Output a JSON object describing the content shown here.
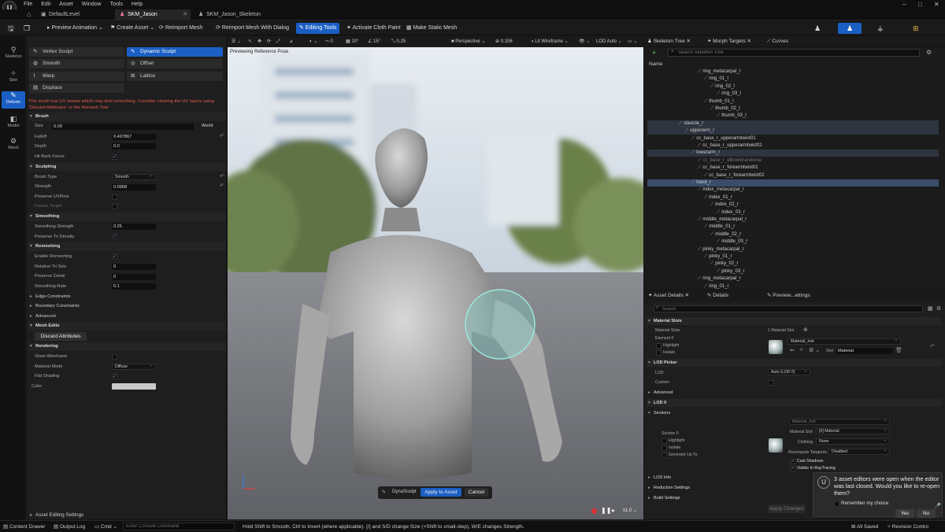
{
  "menu": {
    "items": [
      "File",
      "Edit",
      "Asset",
      "Window",
      "Tools",
      "Help"
    ]
  },
  "window_controls": {
    "minimize": "–",
    "maximize": "□",
    "close": "✕"
  },
  "tabs": [
    {
      "label": "DefaultLevel"
    },
    {
      "label": "SKM_Jason"
    },
    {
      "label": "SKM_Jason_Skeleton"
    }
  ],
  "toolbar": {
    "preview_animation": "Preview Animation",
    "create_asset": "Create Asset",
    "reimport_mesh": "Reimport Mesh",
    "reimport_with_dialog": "Reimport Mesh With Dialog",
    "editing_tools": "Editing Tools",
    "activate_cloth_paint": "Activate Cloth Paint",
    "make_static_mesh": "Make Static Mesh"
  },
  "left_strip": [
    {
      "label": "Skeleton"
    },
    {
      "label": "Skin"
    },
    {
      "label": "Deform"
    },
    {
      "label": "Model"
    },
    {
      "label": "Mesh"
    }
  ],
  "sculpt_modes": [
    {
      "label": "Vertex Sculpt"
    },
    {
      "label": "Dynamic Sculpt"
    },
    {
      "label": "Smooth"
    },
    {
      "label": "Offset"
    },
    {
      "label": "Warp"
    },
    {
      "label": "Lattice"
    },
    {
      "label": "Displace"
    }
  ],
  "warning": "This mesh has UV seams which may limit remeshing. Consider clearing the UV layers using \"Discard Attributes\" or the Remesh Tool.",
  "brush": {
    "header": "Brush",
    "size_label": "Size",
    "size_value": "0.09",
    "world": "World",
    "falloff_label": "Falloff",
    "falloff_value": "0.497867",
    "depth_label": "Depth",
    "depth_value": "0.0",
    "hit_back_label": "Hit Back Faces"
  },
  "sculpting": {
    "header": "Sculpting",
    "brush_type_label": "Brush Type",
    "brush_type_value": "Smooth",
    "strength_label": "Strength",
    "strength_value": "0.0968",
    "preserve_uv_label": "Preserve UVFlow",
    "freeze_label": "Freeze Target"
  },
  "smoothing": {
    "header": "Smoothing",
    "strength_label": "Smoothing Strength",
    "strength_value": "0.25",
    "tri_density_label": "Preserve Tri Density"
  },
  "remeshing": {
    "header": "Remeshing",
    "enable_label": "Enable Remeshing",
    "rel_tri_label": "Relative Tri Size",
    "rel_tri_value": "0",
    "preserve_detail_label": "Preserve Detail",
    "preserve_detail_value": "0",
    "smoothing_rate_label": "Smoothing Rate",
    "smoothing_rate_value": "0.1"
  },
  "collapsed": {
    "edge": "Edge Constraints",
    "boundary": "Boundary Constraints",
    "advanced": "Advanced"
  },
  "mesh_edits": {
    "header": "Mesh Edits",
    "discard": "Discard Attributes"
  },
  "rendering": {
    "header": "Rendering",
    "show_wireframe": "Show Wireframe",
    "material_mode_label": "Material Mode",
    "material_mode_value": "Diffuse",
    "flat_shading": "Flat Shading",
    "color_label": "Color"
  },
  "asset_editing": "Asset Editing Settings",
  "viewport": {
    "perspective": "Perspective",
    "fov": "0.106",
    "lit": "Lit Wireframe",
    "lod": "LOD Auto",
    "previewing": "Previewing Reference Pose",
    "snap_angle": "10°",
    "snap_rot": "15°",
    "snap_scale": "0.25",
    "play_rate": "x1.0"
  },
  "sculpt_bar": {
    "label": "DynaSculpt",
    "apply": "Apply to Asset",
    "cancel": "Cancel"
  },
  "right_tabs": {
    "skeleton_tree": "Skeleton Tree",
    "morph_targets": "Morph Targets",
    "curves": "Curves"
  },
  "skeleton": {
    "search_placeholder": "Search Skeleton Tree",
    "name_header": "Name",
    "bones": [
      "ring_metacarpal_l",
      "ring_01_l",
      "ring_02_l",
      "ring_03_l",
      "thumb_01_l",
      "thumb_02_l",
      "thumb_03_l",
      "clavicle_r",
      "upperarm_r",
      "cc_base_r_upperarmtwist01",
      "cc_base_r_upperarmtwist02",
      "lowerarm_r",
      "cc_base_r_elbowsharebone",
      "cc_base_r_forearmtwist01",
      "cc_base_r_forearmtwist02",
      "hand_r",
      "index_metacarpal_r",
      "index_01_r",
      "index_02_r",
      "index_03_r",
      "middle_metacarpal_r",
      "middle_01_r",
      "middle_02_r",
      "middle_03_r",
      "pinky_metacarpal_r",
      "pinky_01_r",
      "pinky_02_r",
      "pinky_03_r",
      "ring_metacarpal_r",
      "ring_01_r"
    ]
  },
  "details_tabs": {
    "asset_details": "Asset Details",
    "details": "Details",
    "preview": "Preview...ettings"
  },
  "details": {
    "search_placeholder": "Search",
    "material_slots_header": "Material Slots",
    "material_slots_label": "Material Slots",
    "slot_count": "1 Material Slot",
    "element0": "Element 0",
    "highlight": "Highlight",
    "isolate": "Isolate",
    "material_name": "Material_Inst",
    "slot_label": "Slot",
    "slot_value": "Material",
    "lod_picker_header": "LOD Picker",
    "lod_label": "LOD",
    "lod_value": "Auto (LOD 0)",
    "custom_label": "Custom",
    "advanced": "Advanced",
    "lod0_header": "LOD 0",
    "sections": "Sections",
    "section0": "Section 0",
    "sec_highlight": "Highlight",
    "sec_isolate": "Isolate",
    "generate_up_to": "Generate Up To",
    "sec_material": "Material_Inst",
    "material_slot_label": "Material Slot",
    "material_slot_value": "[0] Material",
    "clothing_label": "Clothing",
    "clothing_value": "None",
    "recompute_label": "Recompute Tangents",
    "recompute_value": "Disabled",
    "cast_shadows": "Cast Shadows",
    "visible_raytracing": "Visible In RayTracing",
    "lod_info": "LOD Info",
    "reduction": "Reduction Settings",
    "build": "Build Settings",
    "apply_changes": "Apply Changes"
  },
  "toast": {
    "message": "3 asset editors were open when the editor was last closed. Would you like to re-open them?",
    "remember": "Remember my choice",
    "yes": "Yes",
    "no": "No"
  },
  "status": {
    "content_drawer": "Content Drawer",
    "output_log": "Output Log",
    "cmd": "Cmd",
    "console_placeholder": "Enter Console Command",
    "hint": "Hold Shift to Smooth, Ctrl to Invert (where applicable). [/] and S/D change Size (+Shift to small-step), W/E changes Strength.",
    "all_saved": "All Saved",
    "revision": "Revision Contro"
  },
  "colors": {
    "accent": "#1b5fc4",
    "warning": "#e35b4f"
  }
}
